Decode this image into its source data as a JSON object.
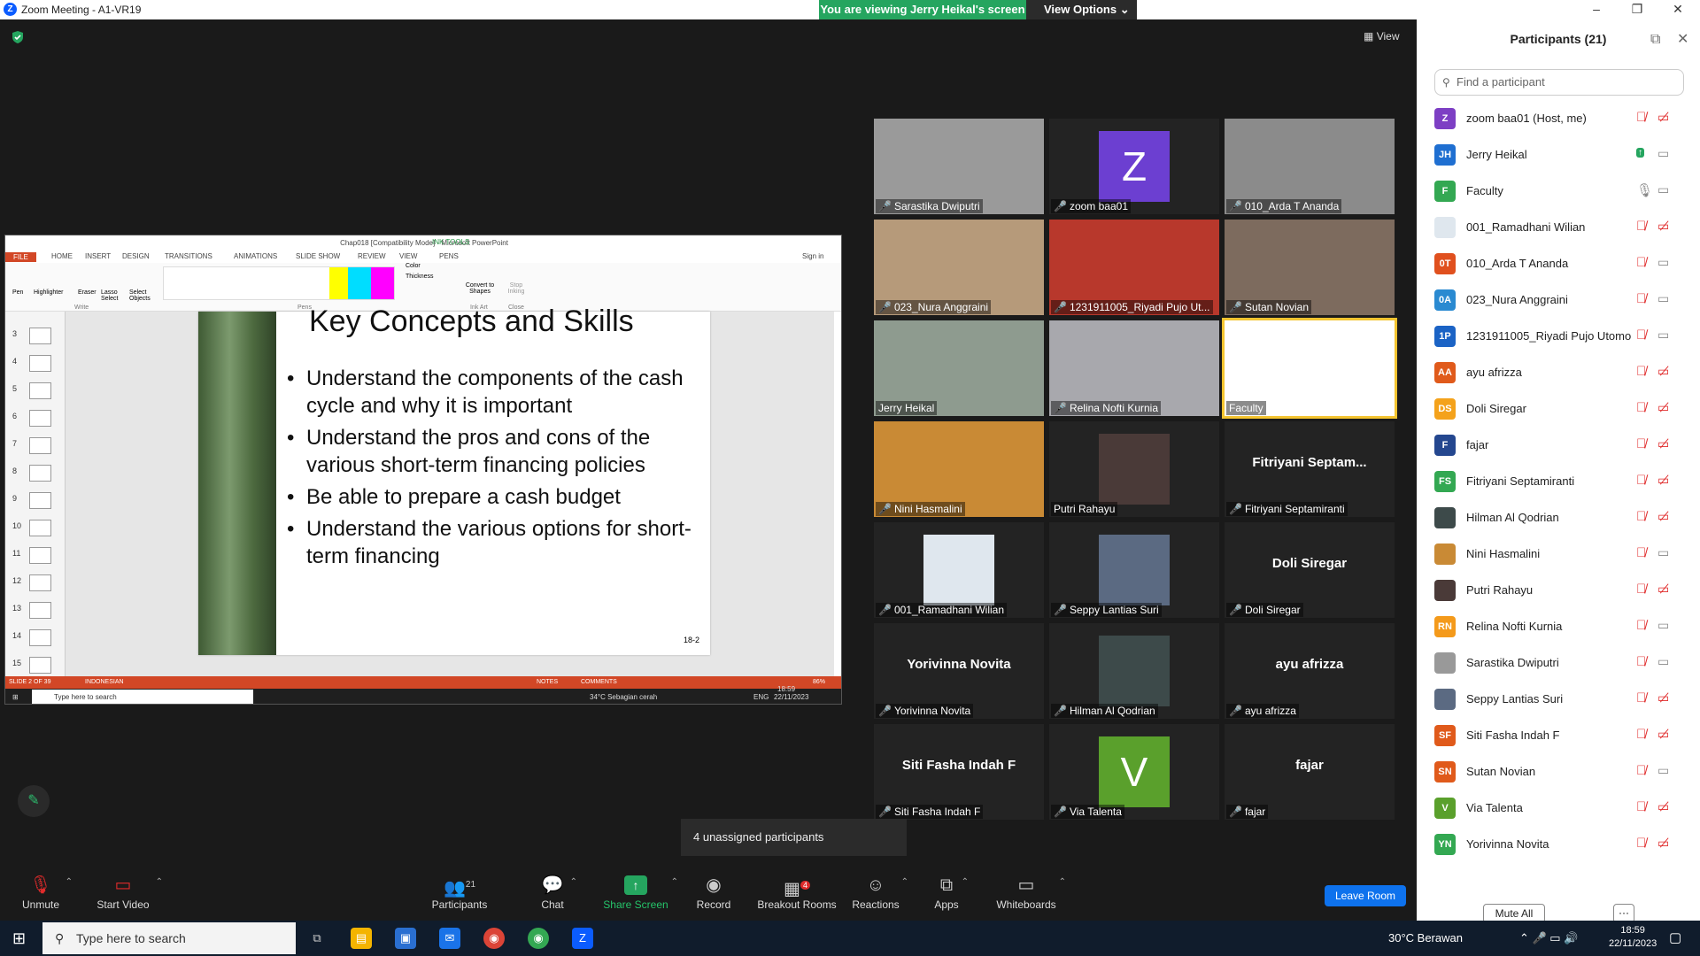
{
  "window": {
    "title": "Zoom Meeting - A1-VR19",
    "min": "–",
    "max": "❐",
    "close": "✕"
  },
  "banner": {
    "viewing": "You are viewing Jerry Heikal's screen",
    "view_options": "View Options"
  },
  "stage": {
    "view_label": "View"
  },
  "ppt": {
    "title": "Chap018 [Compatibility Mode] - Microsoft PowerPoint",
    "tabs": [
      "FILE",
      "HOME",
      "INSERT",
      "DESIGN",
      "TRANSITIONS",
      "ANIMATIONS",
      "SLIDE SHOW",
      "REVIEW",
      "VIEW",
      "PENS"
    ],
    "ink_tools": "INK TOOLS",
    "sign_in": "Sign in",
    "ribbon": {
      "pen": "Pen",
      "highlighter": "Highlighter",
      "eraser": "Eraser",
      "lasso": "Lasso Select",
      "select_objects": "Select Objects",
      "write": "Write",
      "pens": "Pens",
      "color": "Color",
      "thickness": "Thickness",
      "convert": "Convert to Shapes",
      "ink_art": "Ink Art",
      "stop": "Stop Inking",
      "close": "Close"
    },
    "thumb_numbers": [
      "3",
      "4",
      "5",
      "6",
      "7",
      "8",
      "9",
      "10",
      "11",
      "12",
      "13",
      "14",
      "15"
    ],
    "slide": {
      "title": "Key Concepts and Skills",
      "bullets": [
        "Understand the components of the cash cycle and why it is important",
        "Understand the pros and cons of the various short-term financing policies",
        "Be able to prepare a cash budget",
        "Understand the various options for short-term financing"
      ],
      "page": "18-2"
    },
    "status": {
      "slide": "SLIDE 2 OF 39",
      "lang": "INDONESIAN",
      "notes": "NOTES",
      "comments": "COMMENTS",
      "zoom": "86%"
    },
    "taskbar": {
      "search": "Type here to search",
      "weather": "34°C  Sebagian cerah",
      "lang": "ENG",
      "time": "18:59",
      "date": "22/11/2023"
    }
  },
  "tiles": [
    {
      "name": "Sarastika Dwiputri",
      "kind": "video",
      "bg": "#9a9a9a"
    },
    {
      "name": "zoom baa01",
      "kind": "avatar",
      "letter": "Z",
      "bg": "#6c3fd1"
    },
    {
      "name": "010_Arda T Ananda",
      "kind": "video",
      "bg": "#8b8b8b"
    },
    {
      "name": "023_Nura Anggraini",
      "kind": "video",
      "bg": "#b69a7a"
    },
    {
      "name": "1231911005_Riyadi Pujo Ut...",
      "kind": "video",
      "bg": "#b8382c"
    },
    {
      "name": "Sutan Novian",
      "kind": "video",
      "bg": "#7d6b5e"
    },
    {
      "name": "Jerry Heikal",
      "kind": "video",
      "bg": "#8e9b8f",
      "nomic": true
    },
    {
      "name": "Relina Nofti Kurnia",
      "kind": "video",
      "bg": "#a8a8ad"
    },
    {
      "name": "Faculty",
      "kind": "screen",
      "bg": "#ffffff",
      "nomic": true,
      "speaking": true
    },
    {
      "name": "Nini Hasmalini",
      "kind": "video",
      "bg": "#c98a35"
    },
    {
      "name": "Putri Rahayu",
      "kind": "photo",
      "bg": "#4a3a38",
      "nomic": true
    },
    {
      "name": "Fitriyani Septamiranti",
      "kind": "text",
      "big": "Fitriyani  Septam..."
    },
    {
      "name": "001_Ramadhani Wilian",
      "kind": "photo",
      "bg": "#dfe7ee"
    },
    {
      "name": "Seppy Lantias Suri",
      "kind": "photo",
      "bg": "#5b6a82"
    },
    {
      "name": "Doli Siregar",
      "kind": "text",
      "big": "Doli Siregar"
    },
    {
      "name": "Yorivinna Novita",
      "kind": "text",
      "big": "Yorivinna Novita"
    },
    {
      "name": "Hilman Al Qodrian",
      "kind": "photo",
      "bg": "#3d4a4a"
    },
    {
      "name": "ayu afrizza",
      "kind": "text",
      "big": "ayu afrizza"
    },
    {
      "name": "Siti Fasha Indah F",
      "kind": "text",
      "big": "Siti Fasha Indah F"
    },
    {
      "name": "Via Talenta",
      "kind": "avatar",
      "letter": "V",
      "bg": "#5aa02c"
    },
    {
      "name": "fajar",
      "kind": "text",
      "big": "fajar"
    }
  ],
  "toast": "4 unassigned participants",
  "toolbar": {
    "unmute": "Unmute",
    "start_video": "Start Video",
    "participants": "Participants",
    "participants_count": "21",
    "chat": "Chat",
    "share": "Share Screen",
    "record": "Record",
    "breakout": "Breakout Rooms",
    "breakout_badge": "4",
    "reactions": "Reactions",
    "apps": "Apps",
    "whiteboards": "Whiteboards",
    "leave": "Leave Room"
  },
  "panel": {
    "title": "Participants (21)",
    "search_placeholder": "Find a participant",
    "mute_all": "Mute All",
    "more": "···",
    "participants": [
      {
        "initials": "Z",
        "name": "zoom baa01 (Host, me)",
        "color": "#7d3fc4",
        "mic": "muted",
        "video": "off"
      },
      {
        "initials": "JH",
        "name": "Jerry Heikal",
        "color": "#1f6fd1",
        "mic": "share",
        "video": "on"
      },
      {
        "initials": "F",
        "name": "Faculty",
        "color": "#33a852",
        "mic": "on",
        "video": "on"
      },
      {
        "initials": "",
        "name": "001_Ramadhani Wilian",
        "color": "#dfe7ee",
        "mic": "muted",
        "video": "off"
      },
      {
        "initials": "0T",
        "name": "010_Arda T Ananda",
        "color": "#e0501e",
        "mic": "muted",
        "video": "on"
      },
      {
        "initials": "0A",
        "name": "023_Nura Anggraini",
        "color": "#2a8ad1",
        "mic": "muted",
        "video": "on"
      },
      {
        "initials": "1P",
        "name": "1231911005_Riyadi Pujo Utomo",
        "color": "#1b63c5",
        "mic": "muted",
        "video": "on"
      },
      {
        "initials": "AA",
        "name": "ayu afrizza",
        "color": "#e05a1b",
        "mic": "muted",
        "video": "off"
      },
      {
        "initials": "DS",
        "name": "Doli Siregar",
        "color": "#f4a21b",
        "mic": "muted",
        "video": "off"
      },
      {
        "initials": "F",
        "name": "fajar",
        "color": "#24478f",
        "mic": "muted",
        "video": "off"
      },
      {
        "initials": "FS",
        "name": "Fitriyani Septamiranti",
        "color": "#33a852",
        "mic": "muted",
        "video": "off"
      },
      {
        "initials": "",
        "name": "Hilman Al Qodrian",
        "color": "#3d4a4a",
        "mic": "muted",
        "video": "off"
      },
      {
        "initials": "",
        "name": "Nini Hasmalini",
        "color": "#c98a35",
        "mic": "muted",
        "video": "on"
      },
      {
        "initials": "",
        "name": "Putri Rahayu",
        "color": "#4a3a38",
        "mic": "muted",
        "video": "off"
      },
      {
        "initials": "RN",
        "name": "Relina Nofti Kurnia",
        "color": "#f49a1b",
        "mic": "muted",
        "video": "on"
      },
      {
        "initials": "",
        "name": "Sarastika Dwiputri",
        "color": "#999",
        "mic": "muted",
        "video": "on"
      },
      {
        "initials": "",
        "name": "Seppy Lantias Suri",
        "color": "#5b6a82",
        "mic": "muted",
        "video": "off"
      },
      {
        "initials": "SF",
        "name": "Siti Fasha Indah F",
        "color": "#e05a1b",
        "mic": "muted",
        "video": "off"
      },
      {
        "initials": "SN",
        "name": "Sutan Novian",
        "color": "#e05a1b",
        "mic": "muted",
        "video": "on"
      },
      {
        "initials": "V",
        "name": "Via Talenta",
        "color": "#5aa02c",
        "mic": "muted",
        "video": "off"
      },
      {
        "initials": "YN",
        "name": "Yorivinna Novita",
        "color": "#33a852",
        "mic": "muted",
        "video": "off"
      }
    ]
  },
  "taskbar": {
    "search": "Type here to search",
    "weather": "30°C  Berawan",
    "time": "18:59",
    "date": "22/11/2023"
  }
}
